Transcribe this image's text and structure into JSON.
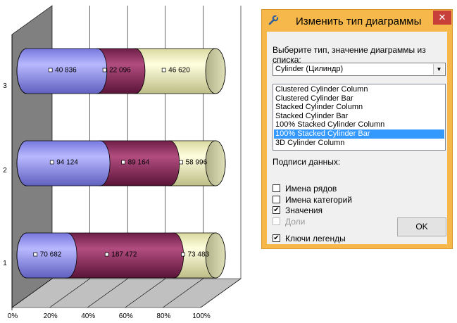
{
  "chart_data": {
    "type": "bar",
    "variant": "100% stacked cylinder bar (3D)",
    "categories": [
      "1",
      "2",
      "3"
    ],
    "series": [
      {
        "values": [
          70682,
          94124,
          40836
        ],
        "color": "#9999ff"
      },
      {
        "values": [
          187472,
          89164,
          22096
        ],
        "color": "#993366"
      },
      {
        "values": [
          73483,
          58996,
          46620
        ],
        "color": "#ffffcc"
      }
    ],
    "data_labels": [
      [
        "70 682",
        "94 124",
        "40 836"
      ],
      [
        "187 472",
        "89 164",
        "22 096"
      ],
      [
        "73 483",
        "58 996",
        "46 620"
      ]
    ],
    "x_ticks": [
      "0%",
      "20%",
      "40%",
      "60%",
      "80%",
      "100%"
    ],
    "xlim": [
      0,
      100
    ],
    "grid": true,
    "legend": "none",
    "colors": {
      "wall": "#808080",
      "floor": "#c0c0c0"
    }
  },
  "dialog": {
    "title": "Изменить тип диаграммы",
    "title_icon": "wrench-icon",
    "close_glyph": "✕",
    "prompt": "Выберите тип, значение диаграммы из списка:",
    "chart_family": "Cylinder (Цилиндр)",
    "dropdown_glyph": "▼",
    "types": [
      {
        "label": "Clustered Cylinder Column",
        "selected": false
      },
      {
        "label": "Clustered Cylinder Bar",
        "selected": false
      },
      {
        "label": "Stacked Cylinder Column",
        "selected": false
      },
      {
        "label": "Stacked Cylinder Bar",
        "selected": false
      },
      {
        "label": "100% Stacked Cylinder Column",
        "selected": false
      },
      {
        "label": "100% Stacked Cylinder Bar",
        "selected": true
      },
      {
        "label": "3D Cylinder Column",
        "selected": false
      }
    ],
    "labels_heading": "Подписи данных:",
    "check_glyph": "✔",
    "options": [
      {
        "label": "Имена рядов",
        "checked": false,
        "disabled": false
      },
      {
        "label": "Имена категорий",
        "checked": false,
        "disabled": false
      },
      {
        "label": "Значения",
        "checked": true,
        "disabled": false
      },
      {
        "label": "Доли",
        "checked": false,
        "disabled": true
      },
      {
        "label": "Ключи легенды",
        "checked": true,
        "disabled": false
      }
    ],
    "ok_label": "OK",
    "colors": {
      "frame": "#f6b84b",
      "selection": "#3399ff",
      "close": "#c7413a"
    }
  }
}
